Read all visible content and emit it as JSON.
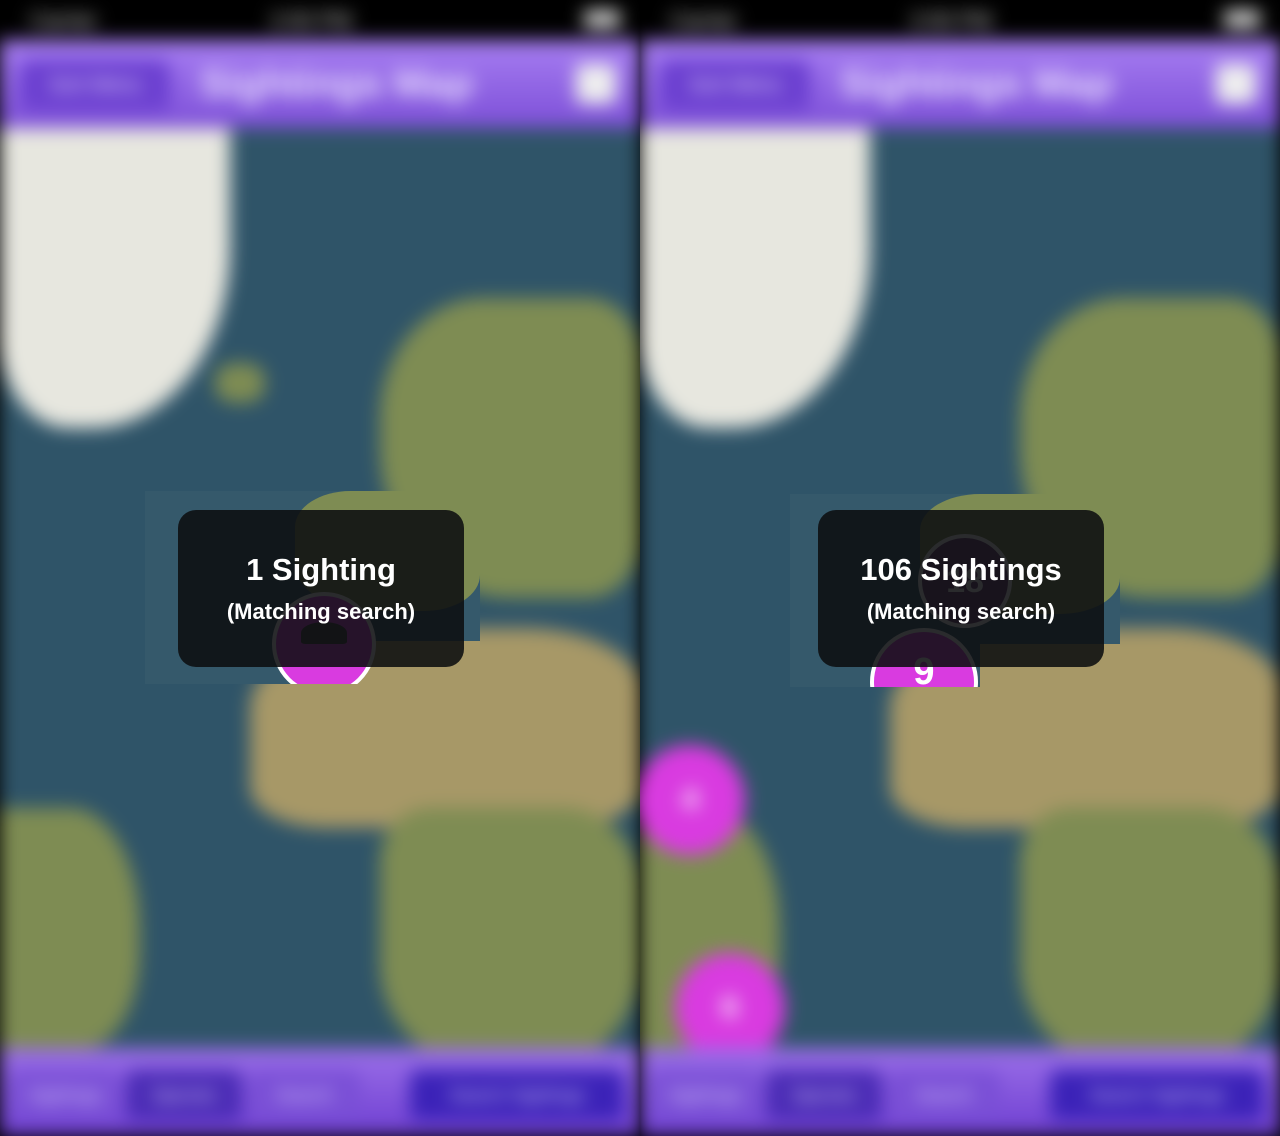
{
  "screens": [
    {
      "status": {
        "carrier": "Carrier",
        "time": "2:00 PM"
      },
      "nav": {
        "back_label": "Sort Menu",
        "title": "Sightings Map"
      },
      "hud": {
        "count": "1 Sighting",
        "sub": "(Matching search)"
      },
      "map_clusters": [],
      "toolbar": {
        "items": [
          "Sightings",
          "Species",
          "Search",
          "Search Sightings"
        ]
      }
    },
    {
      "status": {
        "carrier": "Carrier",
        "time": "2:00 PM"
      },
      "nav": {
        "back_label": "Sort Menu",
        "title": "Sightings Map"
      },
      "hud": {
        "count": "106 Sightings",
        "sub": "(Matching search)"
      },
      "map_clusters": [
        "18",
        "9",
        "4",
        "6"
      ],
      "toolbar": {
        "items": [
          "Sightings",
          "Species",
          "Search",
          "Search Sightings"
        ]
      }
    }
  ],
  "colors": {
    "nav_purple": "#8b5ee0",
    "cluster_magenta": "#d93be0",
    "ocean": "#2f5468",
    "hud_bg": "#0c0e10"
  },
  "icons": {
    "nav_action": "share-icon",
    "sighting_pin": "jellyfish-icon"
  }
}
